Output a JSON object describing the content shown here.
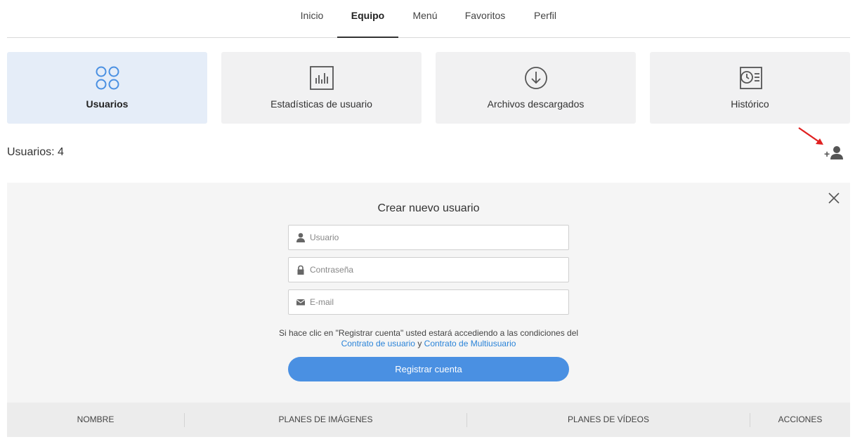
{
  "nav": {
    "tabs": [
      {
        "label": "Inicio",
        "active": false
      },
      {
        "label": "Equipo",
        "active": true
      },
      {
        "label": "Menú",
        "active": false
      },
      {
        "label": "Favoritos",
        "active": false
      },
      {
        "label": "Perfil",
        "active": false
      }
    ]
  },
  "cards": [
    {
      "label": "Usuarios",
      "icon": "users-grid-icon",
      "active": true
    },
    {
      "label": "Estadísticas de usuario",
      "icon": "bar-chart-icon",
      "active": false
    },
    {
      "label": "Archivos descargados",
      "icon": "download-icon",
      "active": false
    },
    {
      "label": "Histórico",
      "icon": "history-icon",
      "active": false
    }
  ],
  "users": {
    "count_label": "Usuarios: 4"
  },
  "form": {
    "title": "Crear nuevo usuario",
    "username_placeholder": "Usuario",
    "password_placeholder": "Contraseña",
    "email_placeholder": "E-mail",
    "terms_prefix": "Si hace clic en \"Registrar cuenta\" usted estará accediendo a las condiciones del",
    "terms_link1": "Contrato de usuario",
    "terms_and": "y",
    "terms_link2": "Contrato de Multiusuario",
    "submit_label": "Registrar cuenta"
  },
  "table": {
    "columns": [
      "NOMBRE",
      "PLANES DE IMÁGENES",
      "PLANES DE VÍDEOS",
      "ACCIONES"
    ]
  },
  "colors": {
    "accent": "#4a90e2",
    "link": "#2a83d8",
    "active_card": "#e5edf8",
    "annotation_arrow": "#e02020"
  }
}
